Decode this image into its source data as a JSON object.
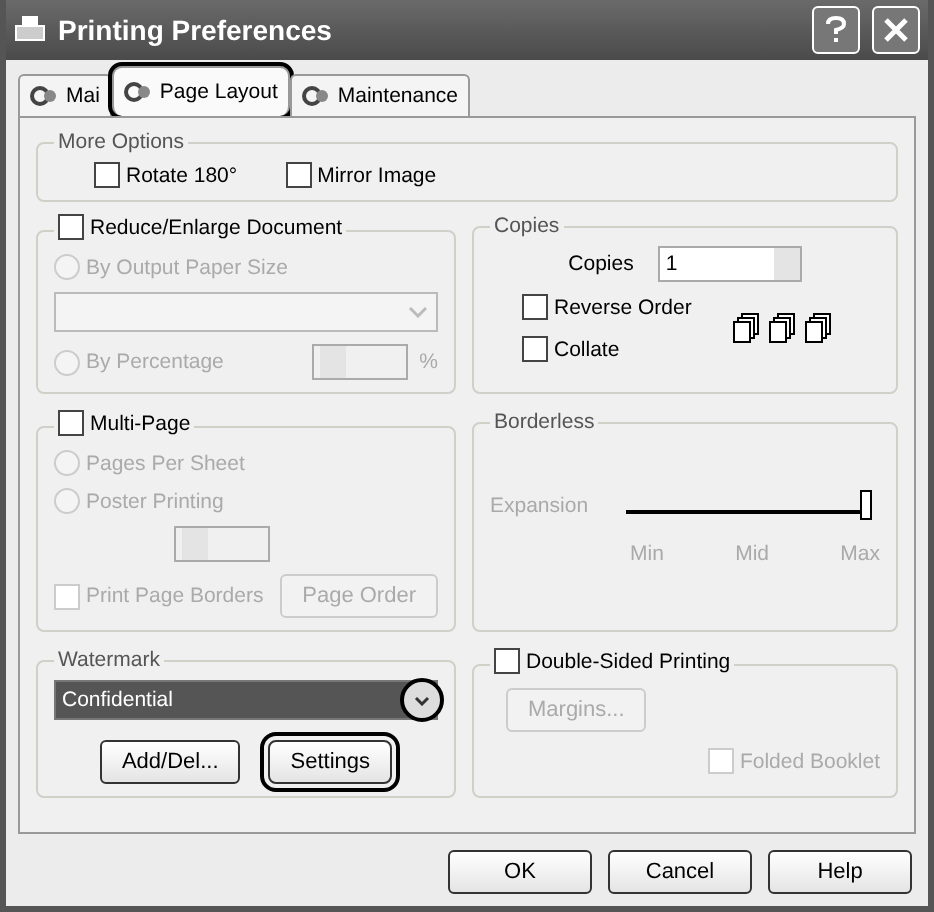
{
  "window": {
    "title": "Printing Preferences"
  },
  "tabs": [
    {
      "label": "Mai",
      "selected": false,
      "callout": false
    },
    {
      "label": "Page Layout",
      "selected": true,
      "callout": true
    },
    {
      "label": "Maintenance",
      "selected": false,
      "callout": false
    }
  ],
  "more_options": {
    "title": "More Options",
    "checkboxes": [
      {
        "label": "Rotate 180°",
        "checked": false,
        "disabled": false
      },
      {
        "label": "Mirror Image",
        "checked": false,
        "disabled": false
      }
    ]
  },
  "reduce_enlarge": {
    "checkbox": {
      "label": "Reduce/Enlarge Document",
      "checked": false,
      "disabled": false
    },
    "output_size": {
      "label": "By Output Paper Size",
      "selected": false,
      "disabled": true
    },
    "paper_dropdown": {
      "disabled": true
    },
    "percentage": {
      "label": "By Percentage",
      "selected": false,
      "disabled": true
    },
    "percent_unit": "%"
  },
  "copies": {
    "title": "Copies",
    "label": "Copies",
    "value": "1",
    "checkboxes": [
      {
        "label": "Reverse Order",
        "checked": false,
        "disabled": false
      },
      {
        "label": "Collate",
        "checked": false,
        "disabled": false
      }
    ]
  },
  "multi_page": {
    "checkbox": {
      "label": "Multi-Page",
      "checked": false,
      "disabled": false
    },
    "radios": [
      {
        "label": "Pages Per Sheet",
        "selected": false,
        "disabled": true
      },
      {
        "label": "Poster Printing",
        "selected": false,
        "disabled": true
      }
    ],
    "print_borders": {
      "label": "Print Page Borders",
      "checked": false,
      "disabled": true
    },
    "page_order_button": {
      "label": "Page Order",
      "disabled": true
    }
  },
  "borderless": {
    "title": "Borderless",
    "slider": {
      "label": "Expansion",
      "level": 1,
      "disabled": true,
      "ticks": [
        "Min",
        "Mid",
        "Max"
      ]
    }
  },
  "watermark": {
    "title": "Watermark",
    "dropdown": {
      "value": "Confidential",
      "callout": true
    },
    "buttons": [
      {
        "label": "Add/Del...",
        "callout": false
      },
      {
        "label": "Settings",
        "callout": true
      }
    ]
  },
  "double_sided": {
    "checkbox": {
      "label": "Double-Sided Printing",
      "checked": false,
      "disabled": false
    },
    "margins_button": {
      "label": "Margins...",
      "disabled": true
    },
    "folded_booklet": {
      "label": "Folded Booklet",
      "checked": false,
      "disabled": true
    }
  },
  "buttons": [
    "OK",
    "Cancel",
    "Help"
  ]
}
